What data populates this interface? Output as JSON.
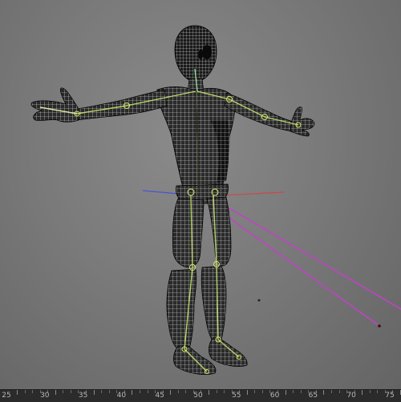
{
  "viewport": {
    "background": "#7a7a7a",
    "wireframe_color": "#ffffff",
    "bone_color": "#b7d36a",
    "axis_x_color": "#c74b4b",
    "axis_z_color": "#4b54d6",
    "ik_line_color": "#c043c6"
  },
  "timeline": {
    "labels": [
      "25",
      "30",
      "35",
      "40",
      "45",
      "50",
      "55",
      "60",
      "65",
      "70",
      "75"
    ]
  }
}
